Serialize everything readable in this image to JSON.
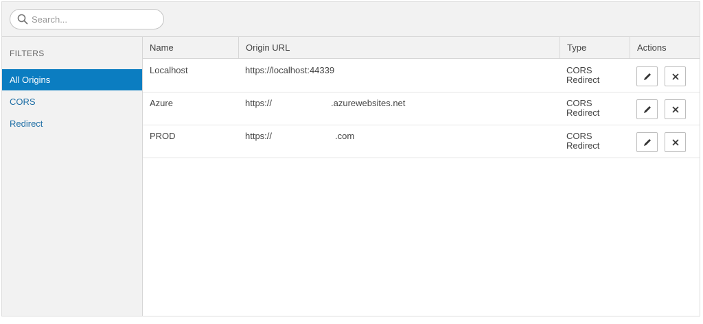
{
  "search": {
    "placeholder": "Search..."
  },
  "sidebar": {
    "title": "FILTERS",
    "items": [
      {
        "label": "All Origins",
        "active": true
      },
      {
        "label": "CORS",
        "active": false
      },
      {
        "label": "Redirect",
        "active": false
      }
    ]
  },
  "table": {
    "headers": {
      "name": "Name",
      "url": "Origin URL",
      "type": "Type",
      "actions": "Actions"
    },
    "rows": [
      {
        "name": "Localhost",
        "url": "https://localhost:44339",
        "type_1": "CORS",
        "type_2": "Redirect"
      },
      {
        "name": "Azure",
        "url": "https://",
        "url_suffix": ".azurewebsites.net",
        "type_1": "CORS",
        "type_2": "Redirect"
      },
      {
        "name": "PROD",
        "url": "https://",
        "url_suffix": ".com",
        "type_1": "CORS",
        "type_2": "Redirect"
      }
    ]
  },
  "colors": {
    "accent": "#0b7dc1",
    "link": "#1e6ea5",
    "panel": "#f2f2f2"
  }
}
